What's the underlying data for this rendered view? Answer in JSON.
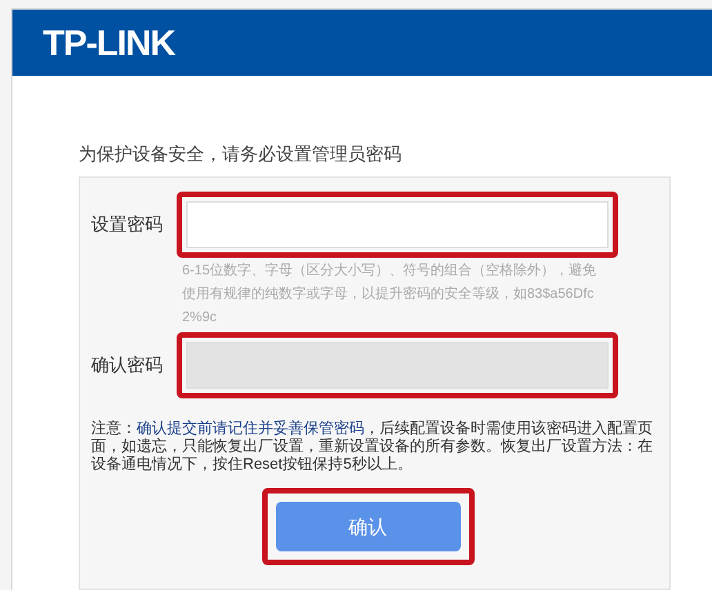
{
  "header": {
    "logo": "TP-LINK"
  },
  "heading": "为保护设备安全，请务必设置管理员密码",
  "fields": [
    {
      "label": "设置密码",
      "disabled": false,
      "highlighted": true,
      "hint": "6-15位数字、字母（区分大小写）、符号的组合（空格除外），避免使用有规律的纯数字或字母，以提升密码的安全等级，如83$a56Dfc2%9c"
    },
    {
      "label": "确认密码",
      "disabled": true,
      "highlighted": true
    }
  ],
  "note": {
    "prefix": "注意：",
    "emphasis": "确认提交前请记住并妥善保管密码",
    "rest": "，后续配置设备时需使用该密码进入配置页面，如遗忘，只能恢复出厂设置，重新设置设备的所有参数。恢复出厂设置方法：在设备通电情况下，按住Reset按钮保持5秒以上。"
  },
  "button": {
    "label": "确认",
    "highlighted": true
  }
}
